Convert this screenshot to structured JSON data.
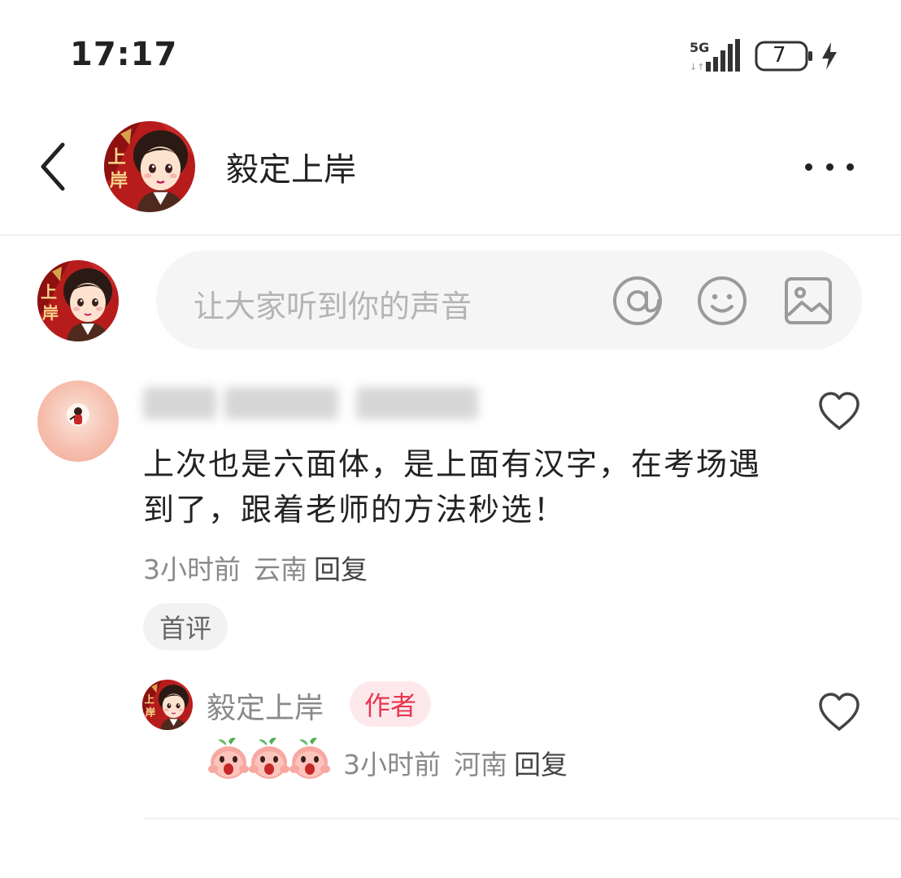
{
  "status_bar": {
    "time": "17:17",
    "network": "5G",
    "battery_level": "7"
  },
  "header": {
    "title": "毅定上岸",
    "back_icon": "chevron-left-icon",
    "more_icon": "more-horizontal-icon"
  },
  "composer": {
    "placeholder": "让大家听到你的声音",
    "icons": [
      "at-icon",
      "emoji-icon",
      "image-icon"
    ]
  },
  "comment": {
    "text": "上次也是六面体，是上面有汉字，在考场遇到了，跟着老师的方法秒选！",
    "time": "3小时前",
    "location": "云南",
    "reply_label": "回复",
    "badge": "首评"
  },
  "reply": {
    "author": "毅定上岸",
    "author_badge": "作者",
    "time": "3小时前",
    "location": "河南",
    "reply_label": "回复",
    "emoji_count": 3
  },
  "colors": {
    "accent_red": "#e8364f",
    "badge_bg": "#fde9ec",
    "muted_text": "#8a8a8a",
    "composer_bg": "#f5f5f5"
  }
}
